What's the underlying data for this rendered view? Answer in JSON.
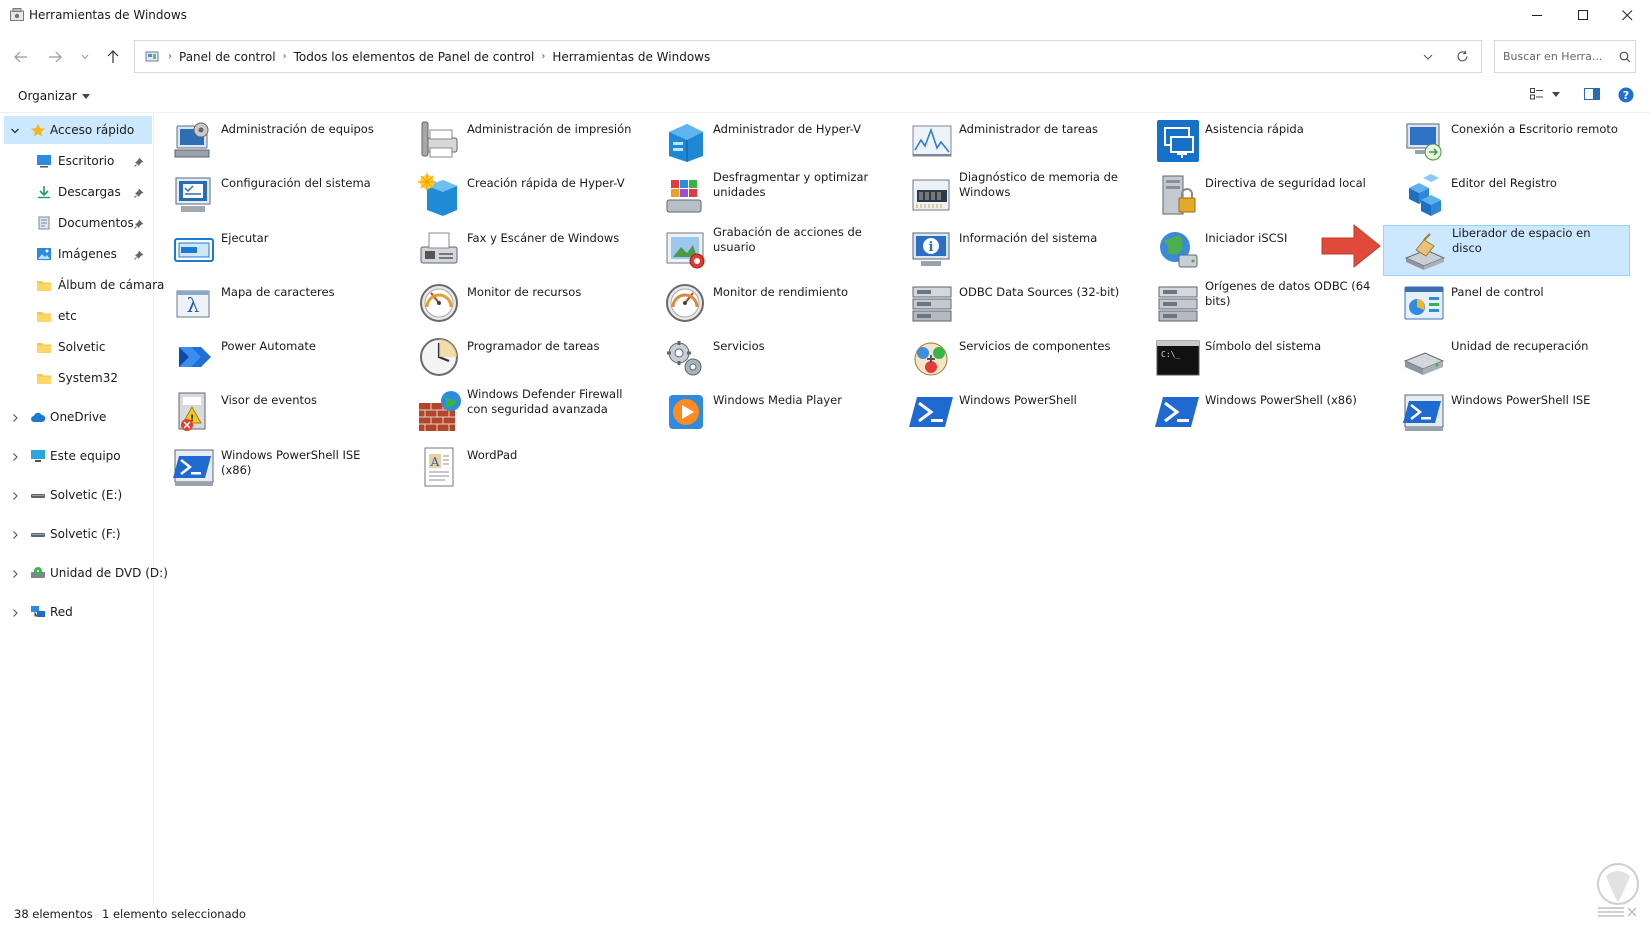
{
  "window": {
    "title": "Herramientas de Windows",
    "minimize_icon": "minimize-icon",
    "maximize_icon": "maximize-icon",
    "close_icon": "close-icon"
  },
  "nav": {
    "back_icon": "arrow-left-icon",
    "forward_icon": "arrow-right-icon",
    "recent_icon": "chevron-down-icon",
    "up_icon": "arrow-up-icon",
    "breadcrumbs": [
      "Panel de control",
      "Todos los elementos de Panel de control",
      "Herramientas de Windows"
    ],
    "search_placeholder": "Buscar en Herra..."
  },
  "command_bar": {
    "organize_label": "Organizar"
  },
  "sidebar": {
    "items": [
      {
        "label": "Acceso rápido",
        "icon": "star-icon",
        "expandable": true,
        "expanded": true,
        "selected": true,
        "level": 0
      },
      {
        "label": "Escritorio",
        "icon": "desktop-icon",
        "pinned": true,
        "level": 1
      },
      {
        "label": "Descargas",
        "icon": "download-icon",
        "pinned": true,
        "level": 1
      },
      {
        "label": "Documentos",
        "icon": "document-icon",
        "pinned": true,
        "level": 1
      },
      {
        "label": "Imágenes",
        "icon": "pictures-icon",
        "pinned": true,
        "level": 1
      },
      {
        "label": "Álbum de cámara",
        "icon": "folder-icon",
        "level": 1
      },
      {
        "label": "etc",
        "icon": "folder-icon",
        "level": 1
      },
      {
        "label": "Solvetic",
        "icon": "folder-icon",
        "level": 1
      },
      {
        "label": "System32",
        "icon": "folder-icon",
        "level": 1
      },
      {
        "label": "OneDrive",
        "icon": "cloud-icon",
        "expandable": true,
        "level": 0
      },
      {
        "label": "Este equipo",
        "icon": "computer-icon",
        "expandable": true,
        "level": 0
      },
      {
        "label": "Solvetic (E:)",
        "icon": "drive-icon",
        "expandable": true,
        "level": 0
      },
      {
        "label": "Solvetic (F:)",
        "icon": "drive-icon",
        "expandable": true,
        "level": 0
      },
      {
        "label": "Unidad de DVD (D:)",
        "icon": "dvd-icon",
        "expandable": true,
        "level": 0
      },
      {
        "label": "Red",
        "icon": "network-icon",
        "expandable": true,
        "level": 0
      }
    ]
  },
  "items": [
    {
      "label": "Administración de equipos",
      "icon": "computer-management-icon"
    },
    {
      "label": "Administración de impresión",
      "icon": "print-management-icon"
    },
    {
      "label": "Administrador de Hyper-V",
      "icon": "hyper-v-icon"
    },
    {
      "label": "Administrador de tareas",
      "icon": "task-manager-icon"
    },
    {
      "label": "Asistencia rápida",
      "icon": "quick-assist-icon"
    },
    {
      "label": "Conexión a Escritorio remoto",
      "icon": "remote-desktop-icon"
    },
    {
      "label": "Configuración del sistema",
      "icon": "system-config-icon"
    },
    {
      "label": "Creación rápida de Hyper-V",
      "icon": "hyper-v-quick-icon"
    },
    {
      "label": "Desfragmentar y optimizar unidades",
      "icon": "defrag-icon"
    },
    {
      "label": "Diagnóstico de memoria de Windows",
      "icon": "memory-diagnostic-icon"
    },
    {
      "label": "Directiva de seguridad local",
      "icon": "security-policy-icon"
    },
    {
      "label": "Editor del Registro",
      "icon": "registry-editor-icon"
    },
    {
      "label": "Ejecutar",
      "icon": "run-icon"
    },
    {
      "label": "Fax y Escáner de Windows",
      "icon": "fax-scan-icon"
    },
    {
      "label": "Grabación de acciones de usuario",
      "icon": "steps-recorder-icon"
    },
    {
      "label": "Información del sistema",
      "icon": "system-info-icon"
    },
    {
      "label": "Iniciador iSCSI",
      "icon": "iscsi-icon"
    },
    {
      "label": "Liberador de espacio en disco",
      "icon": "disk-cleanup-icon",
      "selected": true
    },
    {
      "label": "Mapa de caracteres",
      "icon": "character-map-icon"
    },
    {
      "label": "Monitor de recursos",
      "icon": "resource-monitor-icon"
    },
    {
      "label": "Monitor de rendimiento",
      "icon": "performance-monitor-icon"
    },
    {
      "label": "ODBC Data Sources (32-bit)",
      "icon": "odbc-icon"
    },
    {
      "label": "Orígenes de datos ODBC (64 bits)",
      "icon": "odbc-icon"
    },
    {
      "label": "Panel de control",
      "icon": "control-panel-icon"
    },
    {
      "label": "Power Automate",
      "icon": "power-automate-icon"
    },
    {
      "label": "Programador de tareas",
      "icon": "task-scheduler-icon"
    },
    {
      "label": "Servicios",
      "icon": "services-icon"
    },
    {
      "label": "Servicios de componentes",
      "icon": "component-services-icon"
    },
    {
      "label": "Símbolo del sistema",
      "icon": "command-prompt-icon"
    },
    {
      "label": "Unidad de recuperación",
      "icon": "recovery-drive-icon"
    },
    {
      "label": "Visor de eventos",
      "icon": "event-viewer-icon"
    },
    {
      "label": "Windows Defender Firewall con seguridad avanzada",
      "icon": "firewall-icon"
    },
    {
      "label": "Windows Media Player",
      "icon": "media-player-icon"
    },
    {
      "label": "Windows PowerShell",
      "icon": "powershell-icon"
    },
    {
      "label": "Windows PowerShell (x86)",
      "icon": "powershell-icon"
    },
    {
      "label": "Windows PowerShell ISE",
      "icon": "powershell-ise-icon"
    },
    {
      "label": "Windows PowerShell ISE (x86)",
      "icon": "powershell-ise-icon"
    },
    {
      "label": "WordPad",
      "icon": "wordpad-icon"
    }
  ],
  "status": {
    "count": "38 elementos",
    "selection": "1 elemento seleccionado"
  },
  "colors": {
    "selection_bg": "#cce8ff",
    "selection_border": "#99d1ff",
    "annotation_arrow": "#e04a3a"
  }
}
